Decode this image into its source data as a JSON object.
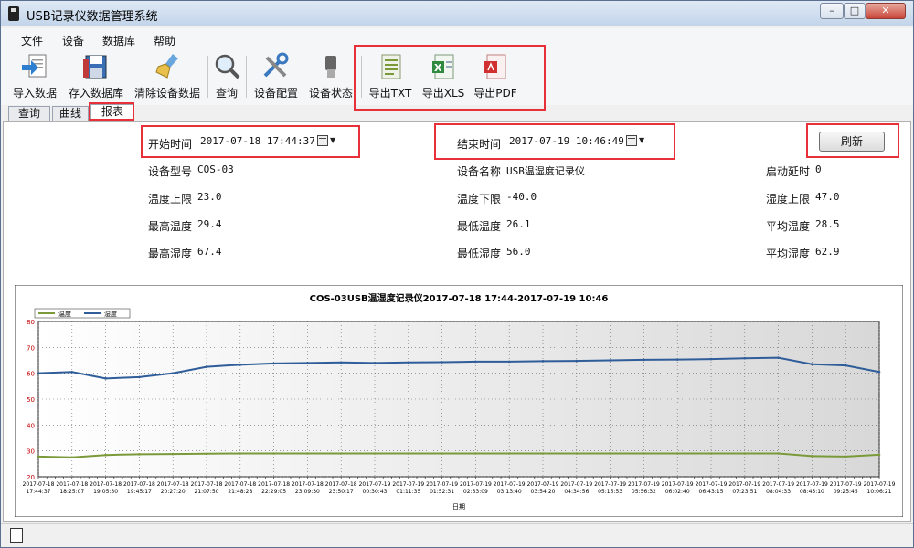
{
  "window": {
    "title": "USB记录仪数据管理系统",
    "controls": [
      "–",
      "□",
      "✕"
    ]
  },
  "menu": [
    "文件",
    "设备",
    "数据库",
    "帮助"
  ],
  "toolbar": [
    {
      "label": "导入数据",
      "icon": "import-icon"
    },
    {
      "label": "存入数据库",
      "icon": "save-db-icon"
    },
    {
      "label": "清除设备数据",
      "icon": "clear-broom-icon"
    },
    {
      "label": "查询",
      "icon": "search-icon"
    },
    {
      "label": "设备配置",
      "icon": "config-tools-icon"
    },
    {
      "label": "设备状态",
      "icon": "usb-status-icon"
    },
    {
      "label": "导出TXT",
      "icon": "txt-file-icon"
    },
    {
      "label": "导出XLS",
      "icon": "xls-file-icon"
    },
    {
      "label": "导出PDF",
      "icon": "pdf-file-icon"
    }
  ],
  "tabs": [
    "查询",
    "曲线",
    "报表"
  ],
  "report": {
    "start_label": "开始时间",
    "start_value": "2017-07-18  17:44:37",
    "end_label": "结束时间",
    "end_value": "2017-07-19  10:46:49",
    "refresh": "刷新",
    "fields": [
      {
        "label": "设备型号",
        "value": "COS-03"
      },
      {
        "label": "设备名称",
        "value": "USB温湿度记录仪"
      },
      {
        "label": "启动延时",
        "value": "0"
      },
      {
        "label": "温度上限",
        "value": "23.0"
      },
      {
        "label": "温度下限",
        "value": "-40.0"
      },
      {
        "label": "湿度上限",
        "value": "47.0"
      },
      {
        "label": "最高温度",
        "value": "29.4"
      },
      {
        "label": "最低温度",
        "value": "26.1"
      },
      {
        "label": "平均温度",
        "value": "28.5"
      },
      {
        "label": "最高湿度",
        "value": "67.4"
      },
      {
        "label": "最低湿度",
        "value": "56.0"
      },
      {
        "label": "平均湿度",
        "value": "62.9"
      }
    ]
  },
  "colors": {
    "temperature": "#7a9a3a",
    "humidity": "#2f5d9a",
    "highlight": "#e8303a"
  },
  "chart_data": {
    "type": "line",
    "title": "COS-03USB温湿度记录仪2017-07-18  17:44-2017-07-19  10:46",
    "xlabel": "日期",
    "ylabel": "",
    "ylim": [
      20,
      80
    ],
    "yticks": [
      20,
      30,
      40,
      50,
      60,
      70,
      80
    ],
    "grid": true,
    "legend": "top-left",
    "x": [
      "2017-07-18 17:44:37",
      "2017-07-18 18:25:07",
      "2017-07-18 19:05:30",
      "2017-07-18 19:45:17",
      "2017-07-18 20:27:20",
      "2017-07-18 21:07:50",
      "2017-07-18 21:48:28",
      "2017-07-18 22:29:05",
      "2017-07-18 23:09:30",
      "2017-07-18 23:50:17",
      "2017-07-19 00:30:43",
      "2017-07-19 01:11:35",
      "2017-07-19 01:52:31",
      "2017-07-19 02:33:09",
      "2017-07-19 03:13:40",
      "2017-07-19 03:54:20",
      "2017-07-19 04:34:56",
      "2017-07-19 05:15:53",
      "2017-07-19 05:56:32",
      "2017-07-19 06:02:40",
      "2017-07-19 06:43:15",
      "2017-07-19 07:23:51",
      "2017-07-19 08:04:33",
      "2017-07-19 08:45:10",
      "2017-07-19 09:25:45",
      "2017-07-19 10:06:21"
    ],
    "series": [
      {
        "name": "温度",
        "values": [
          27.8,
          27.5,
          28.4,
          28.7,
          28.8,
          28.9,
          29.0,
          29.0,
          29.0,
          29.0,
          29.0,
          29.0,
          29.0,
          29.0,
          29.0,
          29.0,
          29.0,
          29.0,
          29.0,
          29.0,
          29.0,
          29.0,
          29.0,
          28.0,
          27.8,
          28.5
        ]
      },
      {
        "name": "湿度",
        "values": [
          60.0,
          60.5,
          58.0,
          58.5,
          60.0,
          62.5,
          63.3,
          63.8,
          64.0,
          64.2,
          64.0,
          64.2,
          64.3,
          64.5,
          64.5,
          64.7,
          64.8,
          65.0,
          65.2,
          65.3,
          65.5,
          65.8,
          66.0,
          63.5,
          63.0,
          60.5
        ]
      }
    ]
  }
}
